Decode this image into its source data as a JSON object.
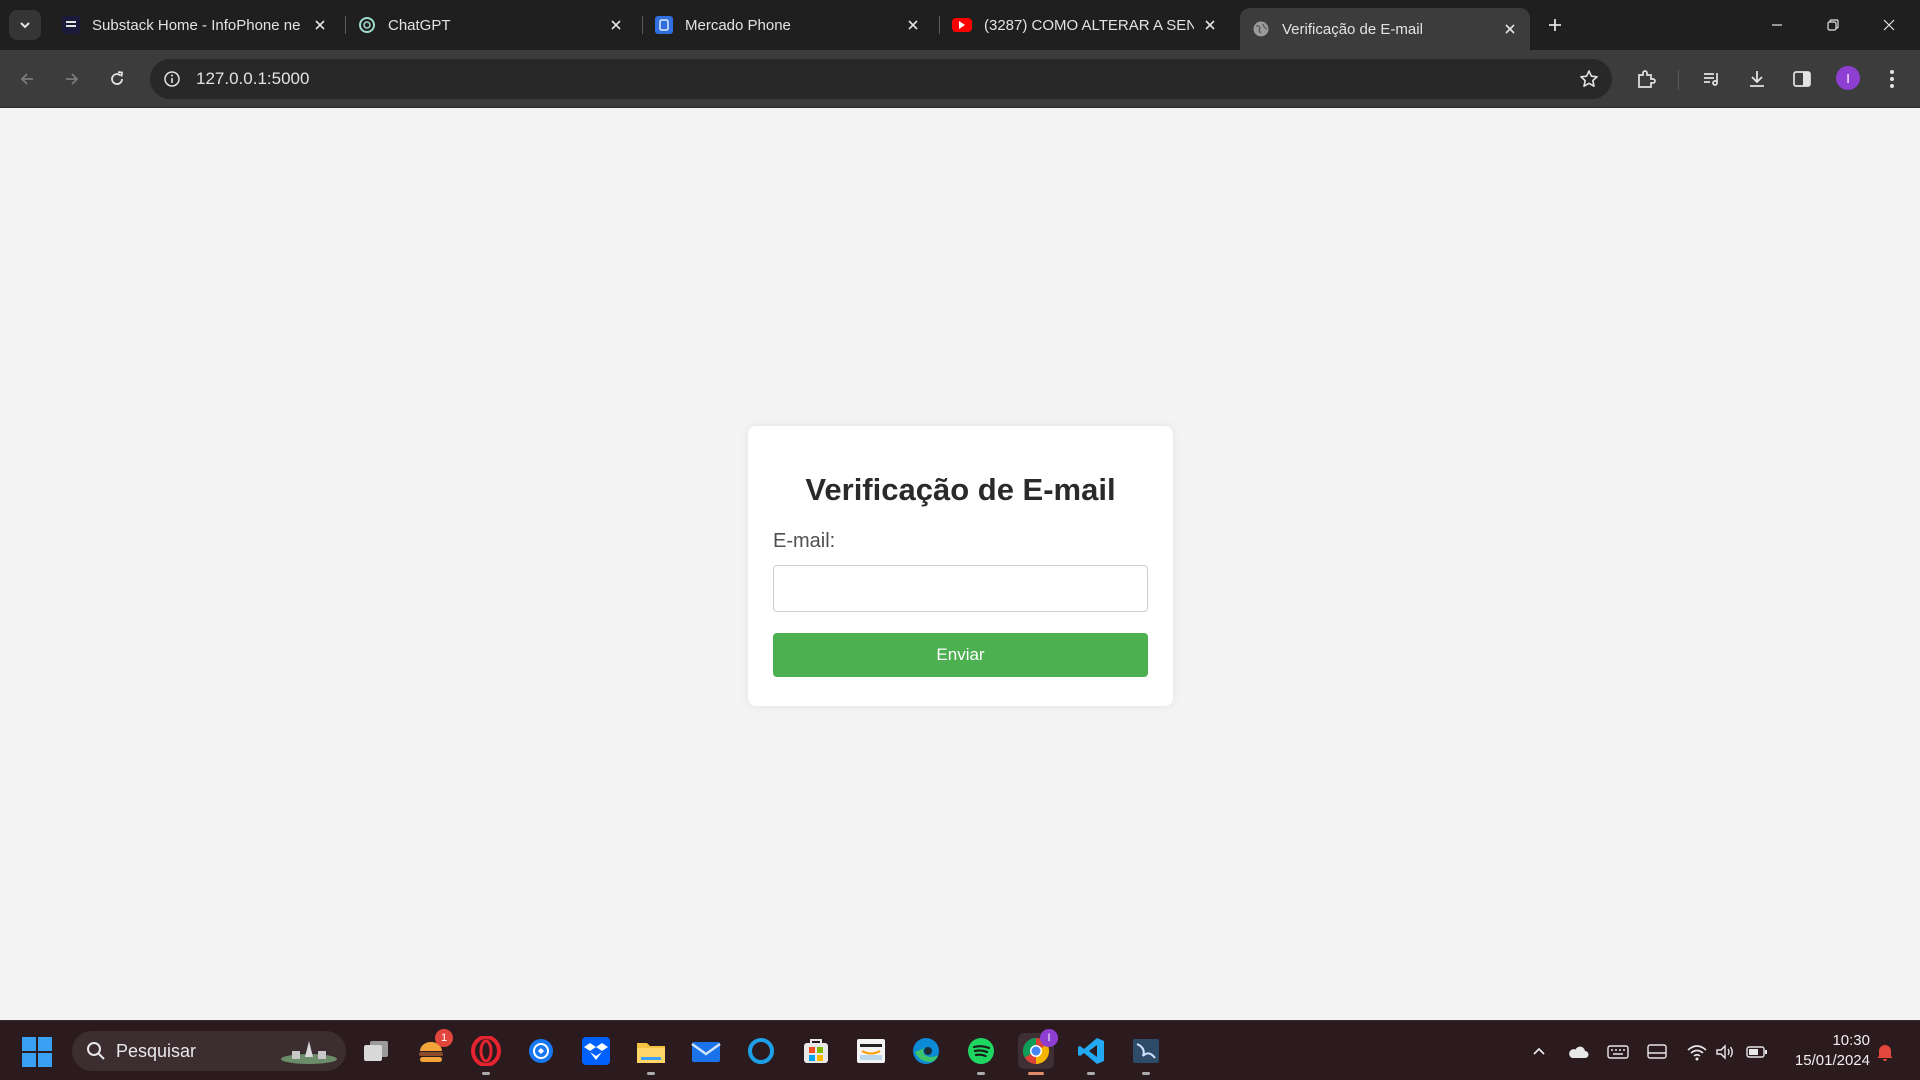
{
  "browser": {
    "tabs": [
      {
        "title": "Substack Home - InfoPhone ne",
        "favicon": "substack-icon",
        "active": false
      },
      {
        "title": "ChatGPT",
        "favicon": "chatgpt-icon",
        "active": false
      },
      {
        "title": "Mercado Phone",
        "favicon": "mercado-phone-icon",
        "active": false
      },
      {
        "title": "(3287) COMO ALTERAR A SENH",
        "favicon": "youtube-icon",
        "active": false
      },
      {
        "title": "Verificação de E-mail",
        "favicon": "globe-icon",
        "active": true
      }
    ],
    "url": "127.0.0.1:5000",
    "profile_initial": "I"
  },
  "page": {
    "title": "Verificação de E-mail",
    "email_label": "E-mail:",
    "email_value": "",
    "submit_label": "Enviar",
    "button_color": "#4caf50"
  },
  "taskbar": {
    "search_label": "Pesquisar",
    "apps": [
      "task-view-icon",
      "food-delivery-icon",
      "opera-icon",
      "messenger-icon",
      "dropbox-icon",
      "file-explorer-icon",
      "mail-icon",
      "cortana-icon",
      "store-icon",
      "amazon-icon",
      "edge-icon",
      "spotify-icon",
      "chrome-icon",
      "vscode-icon",
      "sql-studio-icon"
    ],
    "food_badge": "1",
    "chrome_badge": "I",
    "time": "10:30",
    "date": "15/01/2024"
  }
}
